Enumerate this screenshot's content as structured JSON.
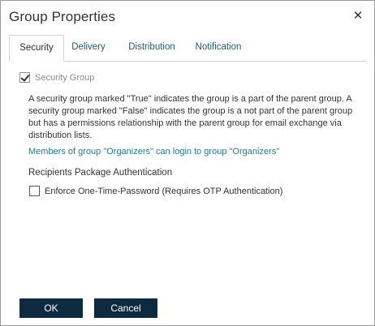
{
  "dialog": {
    "title": "Group Properties",
    "close_icon": "close-icon"
  },
  "tabs": [
    {
      "label": "Security",
      "active": true
    },
    {
      "label": "Delivery",
      "active": false
    },
    {
      "label": "Distribution",
      "active": false
    },
    {
      "label": "Notification",
      "active": false
    }
  ],
  "security": {
    "security_group_label": "Security Group",
    "security_group_checked": true,
    "security_group_disabled": true,
    "description": "A security group marked \"True\" indicates the group is a part of the parent group. A security group marked \"False\" indicates the group is a not part of the parent group but has a permissions relationship with the parent group for email exchange via distribution lists.",
    "login_info": "Members of group \"Organizers\" can login to group \"Organizers\"",
    "recipients_heading": "Recipients Package Authentication",
    "otp_label": "Enforce One-Time-Password (Requires OTP Authentication)",
    "otp_checked": false
  },
  "footer": {
    "ok_label": "OK",
    "cancel_label": "Cancel"
  },
  "colors": {
    "primary_button": "#0e2a40",
    "tab_link": "#1f5b7a",
    "info_link": "#1b7f8c",
    "muted_text": "#8a8a8a"
  }
}
